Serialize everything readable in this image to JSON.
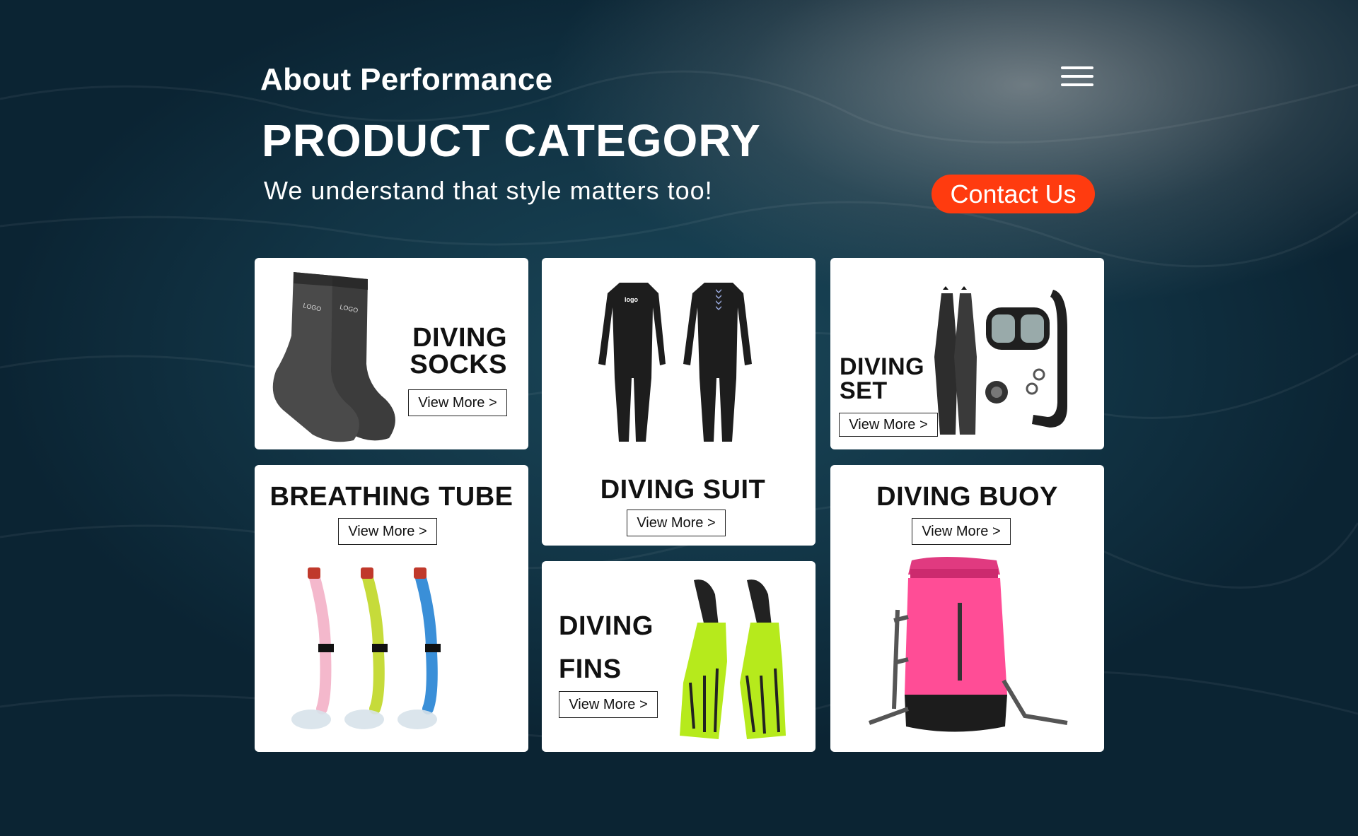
{
  "header": {
    "brand": "About Performance",
    "menu_icon": "hamburger-menu-icon"
  },
  "hero": {
    "title": "PRODUCT CATEGORY",
    "subtitle": "We understand that style matters too!",
    "contact_label": "Contact Us",
    "contact_color": "#ff3b0f"
  },
  "cards": {
    "socks": {
      "line1": "DIVING",
      "line2": "SOCKS",
      "button": "View More >"
    },
    "suit": {
      "title": "DIVING SUIT",
      "button": "View More >",
      "logo_text": "logo"
    },
    "set": {
      "line1": "DIVING",
      "line2": "SET",
      "button": "View More >"
    },
    "tube": {
      "title": "BREATHING TUBE",
      "button": "View More >"
    },
    "fins": {
      "line1": "DIVING",
      "line2": "FINS",
      "button": "View More >"
    },
    "buoy": {
      "title": "DIVING BUOY",
      "button": "View More >"
    }
  },
  "sock_logo_text": "LOGO"
}
